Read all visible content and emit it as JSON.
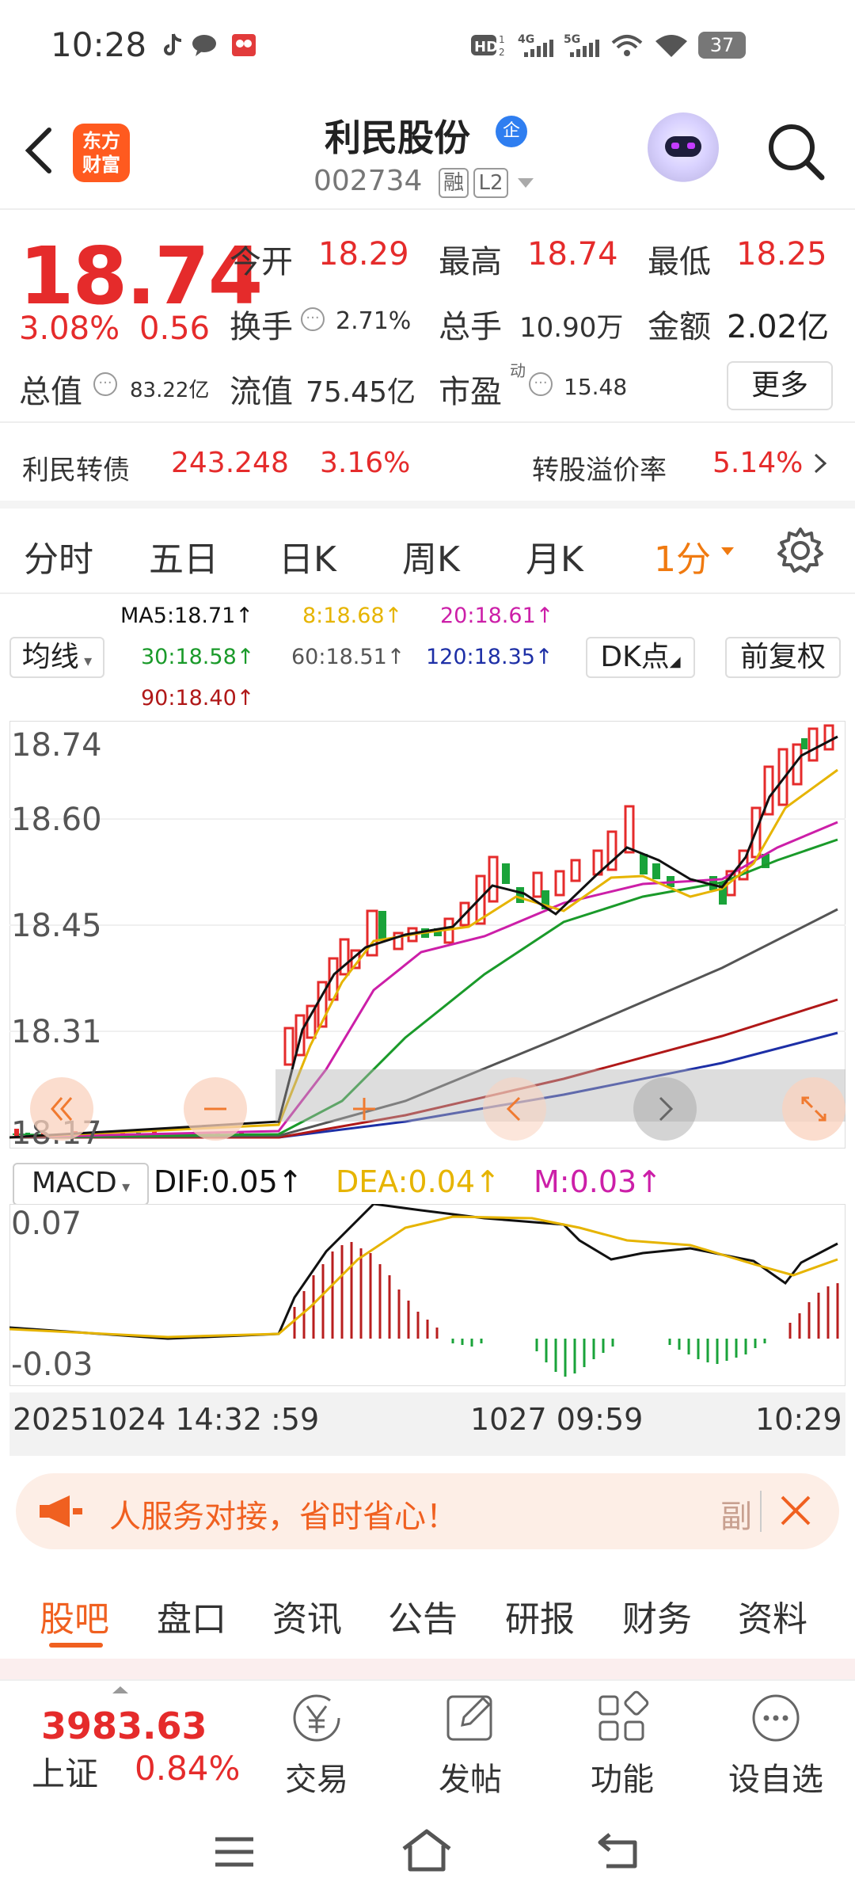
{
  "status": {
    "time": "10:28",
    "battery": "37",
    "net1": "4G",
    "net2": "5G"
  },
  "header": {
    "logo_line1": "东方",
    "logo_line2": "财富",
    "name": "利民股份",
    "badge": "企",
    "code": "002734",
    "tag_rong": "融",
    "tag_l2": "L2"
  },
  "quote": {
    "price": "18.74",
    "change_pct": "3.08%",
    "change_amt": "0.56",
    "open_label": "今开",
    "open": "18.29",
    "high_label": "最高",
    "high": "18.74",
    "low_label": "最低",
    "low": "18.25",
    "turnover_label": "换手",
    "turnover": "2.71%",
    "volume_label": "总手",
    "volume": "10.90万",
    "amount_label": "金额",
    "amount": "2.02亿",
    "mcap_label": "总值",
    "mcap": "83.22亿",
    "float_label": "流值",
    "float": "75.45亿",
    "pe_label": "市盈",
    "pe_sup": "动",
    "pe": "15.48",
    "more": "更多"
  },
  "bond": {
    "label": "利民转债",
    "price": "243.248",
    "pct": "3.16%",
    "premium_label": "转股溢价率",
    "premium": "5.14%"
  },
  "tabs": {
    "t1": "分时",
    "t2": "五日",
    "t3": "日K",
    "t4": "周K",
    "t5": "月K",
    "t6": "1分"
  },
  "ma": {
    "ma5": "MA5:18.71↑",
    "ma8": "8:18.68↑",
    "ma20": "20:18.61↑",
    "ma30": "30:18.58↑",
    "ma60": "60:18.51↑",
    "ma120": "120:18.35↑",
    "ma90": "90:18.40↑",
    "indicator": "均线",
    "dk": "DK点",
    "fq": "前复权"
  },
  "axis": {
    "p1": "18.74",
    "p2": "18.60",
    "p3": "18.45",
    "p4": "18.31",
    "p5": "18.17"
  },
  "macd": {
    "name": "MACD",
    "dif": "DIF:0.05↑",
    "dea": "DEA:0.04↑",
    "m": "M:0.03↑",
    "top": "0.07",
    "bottom": "-0.03"
  },
  "time": {
    "start": "20251024 14:32",
    "start2": ":59",
    "mid": "1027 09:59",
    "end": "10:29"
  },
  "banner": {
    "text": "人服务对接，省时省心！",
    "tail": "副"
  },
  "subtabs": [
    "股吧",
    "盘口",
    "资讯",
    "公告",
    "研报",
    "财务",
    "资料"
  ],
  "bottom": {
    "index_value": "3983.63",
    "index_name": "上证",
    "index_pct": "0.84%",
    "trade": "交易",
    "post": "发帖",
    "func": "功能",
    "watch": "设自选"
  },
  "colors": {
    "up": "#e52b2b",
    "down": "#1aa33a",
    "brand": "#ff5a1f",
    "ma5": "#111111",
    "ma8": "#e6b400",
    "ma20": "#cc1fa8",
    "ma30": "#1a9a2a",
    "ma60": "#555555",
    "ma90": "#b01818",
    "ma120": "#1d2fa6"
  }
}
